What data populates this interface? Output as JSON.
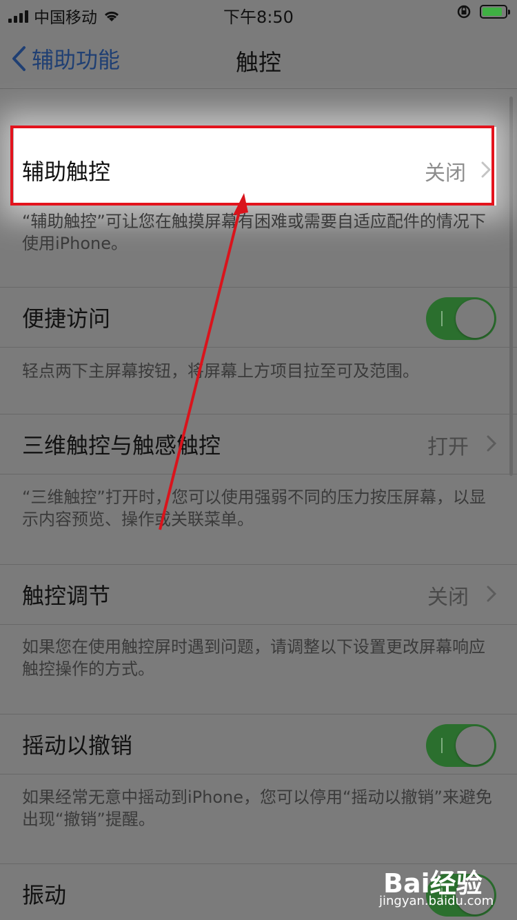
{
  "status_bar": {
    "carrier": "中国移动",
    "time": "下午8:50"
  },
  "nav": {
    "back_label": "辅助功能",
    "title": "触控"
  },
  "rows": {
    "assistive_touch": {
      "label": "辅助触控",
      "value": "关闭",
      "description": "“辅助触控”可让您在触摸屏幕有困难或需要自适应配件的情况下使用iPhone。"
    },
    "reachability": {
      "label": "便捷访问",
      "toggle": "on",
      "description": "轻点两下主屏幕按钮，将屏幕上方项目拉至可及范围。"
    },
    "three_d_touch": {
      "label": "三维触控与触感触控",
      "value": "打开",
      "description": "“三维触控”打开时，您可以使用强弱不同的压力按压屏幕，以显示内容预览、操作或关联菜单。"
    },
    "touch_accommodations": {
      "label": "触控调节",
      "value": "关闭",
      "description": "如果您在使用触控屏时遇到问题，请调整以下设置更改屏幕响应触控操作的方式。"
    },
    "shake_to_undo": {
      "label": "摇动以撤销",
      "toggle": "on",
      "description": "如果经常无意中摇动到iPhone，您可以停用“摇动以撤销”来避免出现“撤销”提醒。"
    },
    "vibration": {
      "label": "振动",
      "toggle": "on"
    }
  },
  "watermark": {
    "logo": "Bai经验",
    "url": "jingyan.baidu.com"
  },
  "colors": {
    "highlight_border": "#e3131d",
    "toggle_on": "#2b6f2e",
    "back_link": "#1f3f73"
  }
}
